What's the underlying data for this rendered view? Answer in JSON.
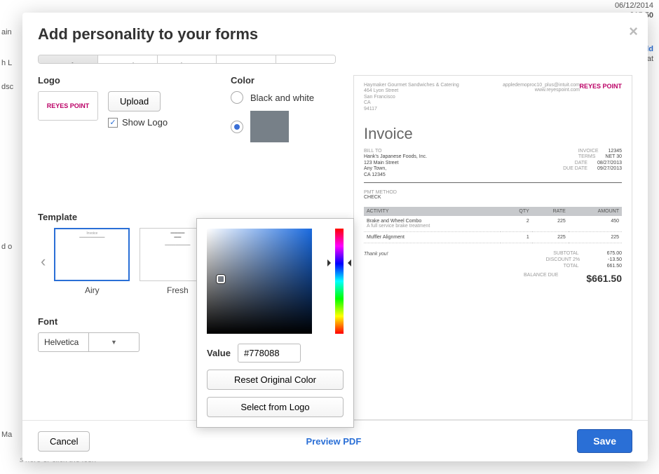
{
  "modal": {
    "title": "Add personality to your forms",
    "tabs": [
      "Style",
      "Header",
      "Columns",
      "Footer",
      "More"
    ],
    "logo": {
      "label": "Logo",
      "upload_btn": "Upload",
      "show_logo_label": "Show Logo",
      "logo_text": "REYES POINT"
    },
    "color": {
      "label": "Color",
      "bw_label": "Black and white",
      "swatch_hex": "#778088"
    },
    "picker": {
      "value_label": "Value",
      "value": "#778088",
      "reset_btn": "Reset Original Color",
      "select_logo_btn": "Select from Logo"
    },
    "template": {
      "label": "Template",
      "items": [
        "Airy",
        "Fresh"
      ]
    },
    "font": {
      "label": "Font",
      "value": "Helvetica"
    },
    "footer": {
      "cancel": "Cancel",
      "preview": "Preview PDF",
      "save": "Save"
    }
  },
  "preview": {
    "company": {
      "name": "Haymaker Gourmet Sandwiches & Catering",
      "addr1": "464 Lyon Street",
      "addr2": "San Francisco",
      "addr3": "CA",
      "addr4": "94117"
    },
    "contact": {
      "email": "appledemoproc10_plus@intuit.com",
      "web": "www.reyespoint.com"
    },
    "logo_text": "REYES POINT",
    "doc_title": "Invoice",
    "billto": {
      "label": "BILL TO",
      "name": "Hank's Japanese Foods, Inc.",
      "addr1": "123 Main Street",
      "addr2": "Any Town,",
      "addr3": "CA 12345"
    },
    "nums": [
      {
        "label": "INVOICE",
        "value": "12345"
      },
      {
        "label": "TERMS",
        "value": "NET 30"
      },
      {
        "label": "DATE",
        "value": "08/27/2013"
      },
      {
        "label": "DUE DATE",
        "value": "09/27/2013"
      }
    ],
    "pmt": {
      "label": "PMT METHOD",
      "value": "CHECK"
    },
    "columns": [
      "ACTIVITY",
      "QTY",
      "RATE",
      "AMOUNT"
    ],
    "lines": [
      {
        "activity": "Brake and Wheel Combo",
        "sub": "A full service brake treatment",
        "qty": "2",
        "rate": "225",
        "amount": "450"
      },
      {
        "activity": "Muffler Alignment",
        "sub": "",
        "qty": "1",
        "rate": "225",
        "amount": "225"
      }
    ],
    "thanks": "Thank you!",
    "totals": [
      {
        "label": "SUBTOTAL",
        "value": "675.00"
      },
      {
        "label": "DISCOUNT 2%",
        "value": "-13.50"
      },
      {
        "label": "TOTAL",
        "value": "661.50"
      }
    ],
    "balance": {
      "label": "BALANCE DUE",
      "value": "$661.50"
    }
  },
  "backdrop": {
    "date": "06/12/2014",
    "amt": "$15.50",
    "add": "dd",
    "batch": "Bat",
    "c1": "ain",
    "c2": "h L",
    "c3": "dsc",
    "c4": "d o",
    "c5": "Ma",
    "hint": "s here or click the icon"
  }
}
